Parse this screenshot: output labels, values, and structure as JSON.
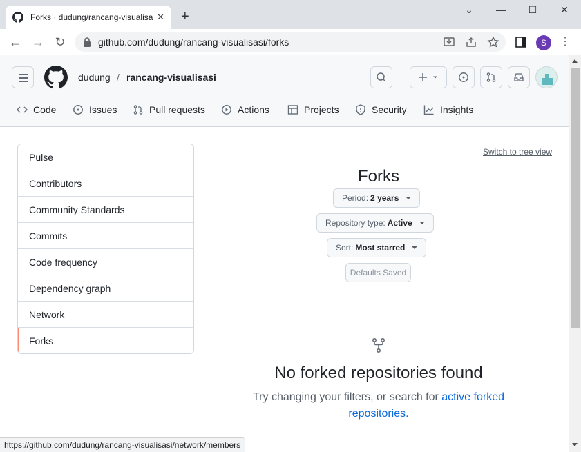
{
  "browser": {
    "tab_title": "Forks · dudung/rancang-visualisasi",
    "url": "github.com/dudung/rancang-visualisasi/forks",
    "profile_initial": "S",
    "status_url": "https://github.com/dudung/rancang-visualisasi/network/members"
  },
  "repo": {
    "owner": "dudung",
    "separator": "/",
    "name": "rancang-visualisasi"
  },
  "reponav": [
    {
      "label": "Code",
      "icon": "code-icon"
    },
    {
      "label": "Issues",
      "icon": "issue-icon"
    },
    {
      "label": "Pull requests",
      "icon": "pull-request-icon"
    },
    {
      "label": "Actions",
      "icon": "play-icon"
    },
    {
      "label": "Projects",
      "icon": "table-icon"
    },
    {
      "label": "Security",
      "icon": "shield-icon"
    },
    {
      "label": "Insights",
      "icon": "graph-icon"
    }
  ],
  "sidebar": {
    "items": [
      {
        "label": "Pulse"
      },
      {
        "label": "Contributors"
      },
      {
        "label": "Community Standards"
      },
      {
        "label": "Commits"
      },
      {
        "label": "Code frequency"
      },
      {
        "label": "Dependency graph"
      },
      {
        "label": "Network"
      },
      {
        "label": "Forks"
      }
    ],
    "selected": "Forks"
  },
  "main": {
    "tree_view_link": "Switch to tree view",
    "title": "Forks",
    "period": {
      "label": "Period:",
      "value": "2 years"
    },
    "repo_type": {
      "label": "Repository type:",
      "value": "Active"
    },
    "sort": {
      "label": "Sort:",
      "value": "Most starred"
    },
    "defaults_button": "Defaults Saved",
    "empty_title": "No forked repositories found",
    "empty_desc_prefix": "Try changing your filters, or search for ",
    "empty_desc_link": "active forked repositories."
  },
  "colors": {
    "selected_accent": "#fd8c73",
    "link": "#0969da",
    "profile": "#6a3ab4"
  }
}
